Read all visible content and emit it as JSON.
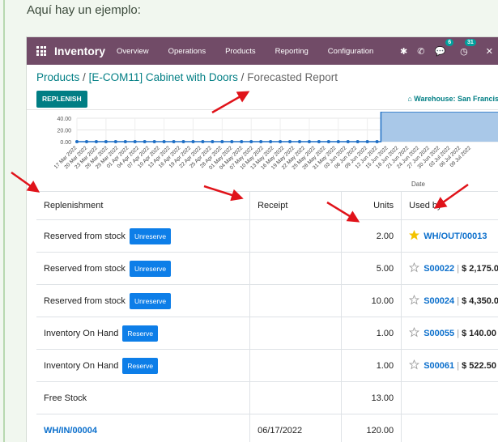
{
  "intro_text": "Aquí hay un ejemplo:",
  "navbar": {
    "app_title": "Inventory",
    "menu": [
      "Overview",
      "Operations",
      "Products",
      "Reporting",
      "Configuration"
    ],
    "chat_count": "6",
    "activity_count": "31"
  },
  "breadcrumb": {
    "products": "Products",
    "separator": "/",
    "product": "[E-COM11] Cabinet with Doors",
    "current": "Forecasted Report"
  },
  "replenish_label": "REPLENISH",
  "warehouse_label": "Warehouse: San Francisc",
  "chart_data": {
    "type": "area",
    "y_ticks": [
      "40.00",
      "20.00",
      "0.00"
    ],
    "x_labels": [
      "17 Mar 2022",
      "20 Mar 2022",
      "23 Mar 2022",
      "26 Mar 2022",
      "29 Mar 2022",
      "01 Apr 2022",
      "04 Apr 2022",
      "07 Apr 2022",
      "10 Apr 2022",
      "13 Apr 2022",
      "16 Apr 2022",
      "19 Apr 2022",
      "22 Apr 2022",
      "25 Apr 2022",
      "28 Apr 2022",
      "01 May 2022",
      "04 May 2022",
      "07 May 2022",
      "10 May 2022",
      "13 May 2022",
      "16 May 2022",
      "19 May 2022",
      "22 May 2022",
      "25 May 2022",
      "28 May 2022",
      "31 May 2022",
      "03 Jun 2022",
      "06 Jun 2022",
      "09 Jun 2022",
      "12 Jun 2022",
      "15 Jun 2022",
      "18 Jun 2022",
      "21 Jun 2022",
      "24 Jun 2022",
      "27 Jun 2022",
      "30 Jun 2022",
      "03 Jul 2022",
      "06 Jul 2022",
      "09 Jul 2022"
    ],
    "xlabel": "Date",
    "rise_index": 31,
    "point_count": 46,
    "low_value": 0,
    "high_value": 120
  },
  "table": {
    "headers": [
      "Replenishment",
      "Receipt",
      "Units",
      "Used by"
    ],
    "rows": [
      {
        "replenishment": "Reserved from stock",
        "button": "Unreserve",
        "receipt": "",
        "units": "2.00",
        "starred": true,
        "ref": "WH/OUT/00013",
        "amount": ""
      },
      {
        "replenishment": "Reserved from stock",
        "button": "Unreserve",
        "receipt": "",
        "units": "5.00",
        "starred": false,
        "ref": "S00022",
        "amount": "$ 2,175.0"
      },
      {
        "replenishment": "Reserved from stock",
        "button": "Unreserve",
        "receipt": "",
        "units": "10.00",
        "starred": false,
        "ref": "S00024",
        "amount": "$ 4,350.0"
      },
      {
        "replenishment": "Inventory On Hand",
        "button": "Reserve",
        "receipt": "",
        "units": "1.00",
        "starred": false,
        "ref": "S00055",
        "amount": "$ 140.00"
      },
      {
        "replenishment": "Inventory On Hand",
        "button": "Reserve",
        "receipt": "",
        "units": "1.00",
        "starred": false,
        "ref": "S00061",
        "amount": "$ 522.50"
      },
      {
        "replenishment": "Free Stock",
        "button": "",
        "receipt": "",
        "units": "13.00",
        "starred": false,
        "ref": "",
        "amount": ""
      },
      {
        "replenishment": "WH/IN/00004",
        "button": "",
        "receipt": "06/17/2022",
        "units": "120.00",
        "starred": false,
        "ref": "",
        "amount": "",
        "is_link": true
      }
    ]
  },
  "colors": {
    "navbar": "#714b67",
    "primary": "#017e84",
    "button_blue": "#0d7ee8",
    "arrow": "#e0131a",
    "star": "#f3c200"
  }
}
